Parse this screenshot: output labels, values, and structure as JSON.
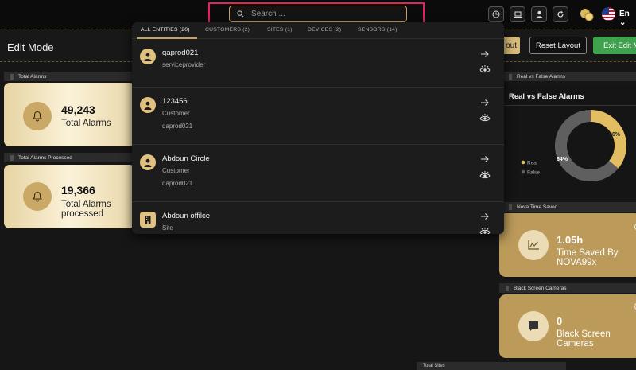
{
  "topbar": {
    "search_placeholder": "Search ...",
    "icons": [
      "clock-icon",
      "laptop-icon",
      "user-icon",
      "refresh-icon",
      "coins-icon"
    ],
    "language": "En"
  },
  "edit_bar": {
    "title": "Edit Mode",
    "layout_button_partial": "out",
    "reset_layout": "Reset Layout",
    "exit_edit_mode": "Exit Edit M"
  },
  "search_dropdown": {
    "tabs": [
      {
        "label": "ALL ENTITIES (20)",
        "active": true
      },
      {
        "label": "CUSTOMERS (2)",
        "active": false
      },
      {
        "label": "SITES (1)",
        "active": false
      },
      {
        "label": "DEVICES (2)",
        "active": false
      },
      {
        "label": "SENSORS (14)",
        "active": false
      }
    ],
    "results": [
      {
        "name": "qaprod021",
        "type": "serviceprovider",
        "parent": "",
        "icon": "user-icon"
      },
      {
        "name": "123456",
        "type": "Customer",
        "parent": "qaprod021",
        "icon": "user-icon"
      },
      {
        "name": "Abdoun Circle",
        "type": "Customer",
        "parent": "qaprod021",
        "icon": "user-icon"
      },
      {
        "name": "Abdoun offilce",
        "type": "Site",
        "parent": "",
        "icon": "building-icon"
      }
    ]
  },
  "widgets": {
    "total_alarms": {
      "header": "Total Alarms",
      "value": "49,243",
      "label": "Total Alarms"
    },
    "total_alarms_processed": {
      "header": "Total Alarms Processed",
      "value": "19,366",
      "label_line1": "Total Alarms",
      "label_line2": "processed"
    },
    "real_vs_false": {
      "header": "Real vs False Alarms",
      "title": "Real vs False Alarms",
      "legend": [
        "Real",
        "False"
      ],
      "pct_real": "36%",
      "pct_false": "64%"
    },
    "nova_time_saved": {
      "header": "Nova Time Saved",
      "value": "1.05h",
      "label_line1": "Time Saved By",
      "label_line2": "NOVA99x"
    },
    "black_screen": {
      "header": "Black Screen Cameras",
      "value": "0",
      "label_line1": "Black Screen",
      "label_line2": "Cameras"
    },
    "total_sites": {
      "header": "Total Sites"
    }
  },
  "chart_data": {
    "type": "pie",
    "title": "Real vs False Alarms",
    "categories": [
      "Real",
      "False"
    ],
    "values": [
      36,
      64
    ],
    "colors": [
      "#e2bd62",
      "#5f5f5f"
    ]
  },
  "colors": {
    "accent": "#c8a45a",
    "highlight": "#e0245e",
    "exit_green": "#3fa34d"
  }
}
